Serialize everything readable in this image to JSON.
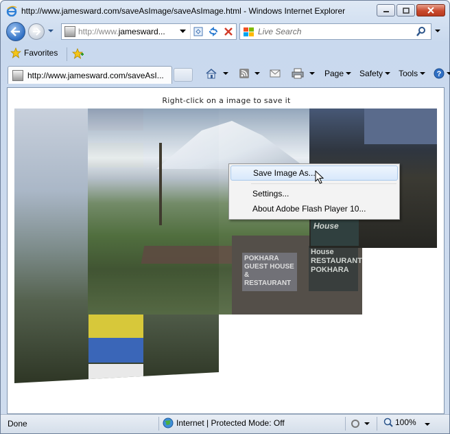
{
  "window": {
    "title": "http://www.jamesward.com/saveAsImage/saveAsImage.html - Windows Internet Explorer"
  },
  "navbar": {
    "address_prefix": "http://www.",
    "address_domain": "jamesward...",
    "search_placeholder": "Live Search"
  },
  "favorites": {
    "label": "Favorites"
  },
  "tab": {
    "label": "http://www.jamesward.com/saveAsI..."
  },
  "commandbar": {
    "page": "Page",
    "safety": "Safety",
    "tools": "Tools"
  },
  "content": {
    "instruction": "Right-click on a image to save it"
  },
  "photos": {
    "sign_left": "POKHARA GUEST HOUSE & RESTAURANT",
    "sign_right": "House RESTAURANT POKHARA",
    "sign_corner": "House"
  },
  "context_menu": {
    "items": [
      "Save Image As...",
      "Settings...",
      "About Adobe Flash Player 10..."
    ]
  },
  "statusbar": {
    "status": "Done",
    "zone": "Internet | Protected Mode: Off",
    "zoom": "100%"
  }
}
